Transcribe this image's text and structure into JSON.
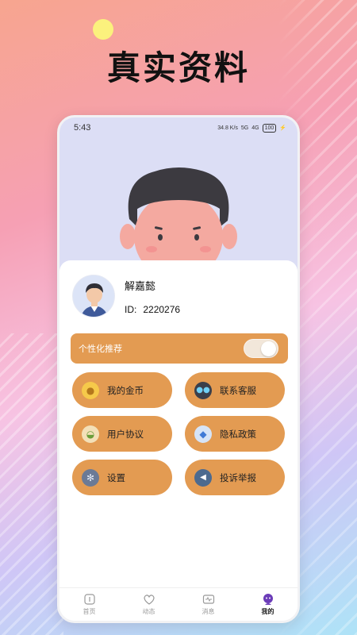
{
  "promo": {
    "title": "真实资料"
  },
  "status_bar": {
    "time": "5:43",
    "speed": "34.8 K/s",
    "network": "5G",
    "signal": "4G",
    "battery": "100"
  },
  "profile": {
    "nickname": "解嘉懿",
    "id_label": "ID:",
    "id_value": "2220276"
  },
  "toggle": {
    "label": "个性化推荐",
    "enabled": true
  },
  "menu": {
    "coins": {
      "label": "我的金币",
      "icon": "coin-icon"
    },
    "service": {
      "label": "联系客服",
      "icon": "robot-icon"
    },
    "agreement": {
      "label": "用户协议",
      "icon": "bowl-icon"
    },
    "privacy": {
      "label": "隐私政策",
      "icon": "shield-icon"
    },
    "settings": {
      "label": "设置",
      "icon": "gear-icon"
    },
    "report": {
      "label": "投诉举报",
      "icon": "megaphone-icon"
    }
  },
  "tabs": [
    {
      "label": "首页",
      "icon": "home-icon"
    },
    {
      "label": "动态",
      "icon": "heart-icon"
    },
    {
      "label": "消息",
      "icon": "message-icon"
    },
    {
      "label": "我的",
      "icon": "profile-icon"
    }
  ],
  "colors": {
    "accent": "#e39b52",
    "hero_bg": "#dcdef5"
  }
}
